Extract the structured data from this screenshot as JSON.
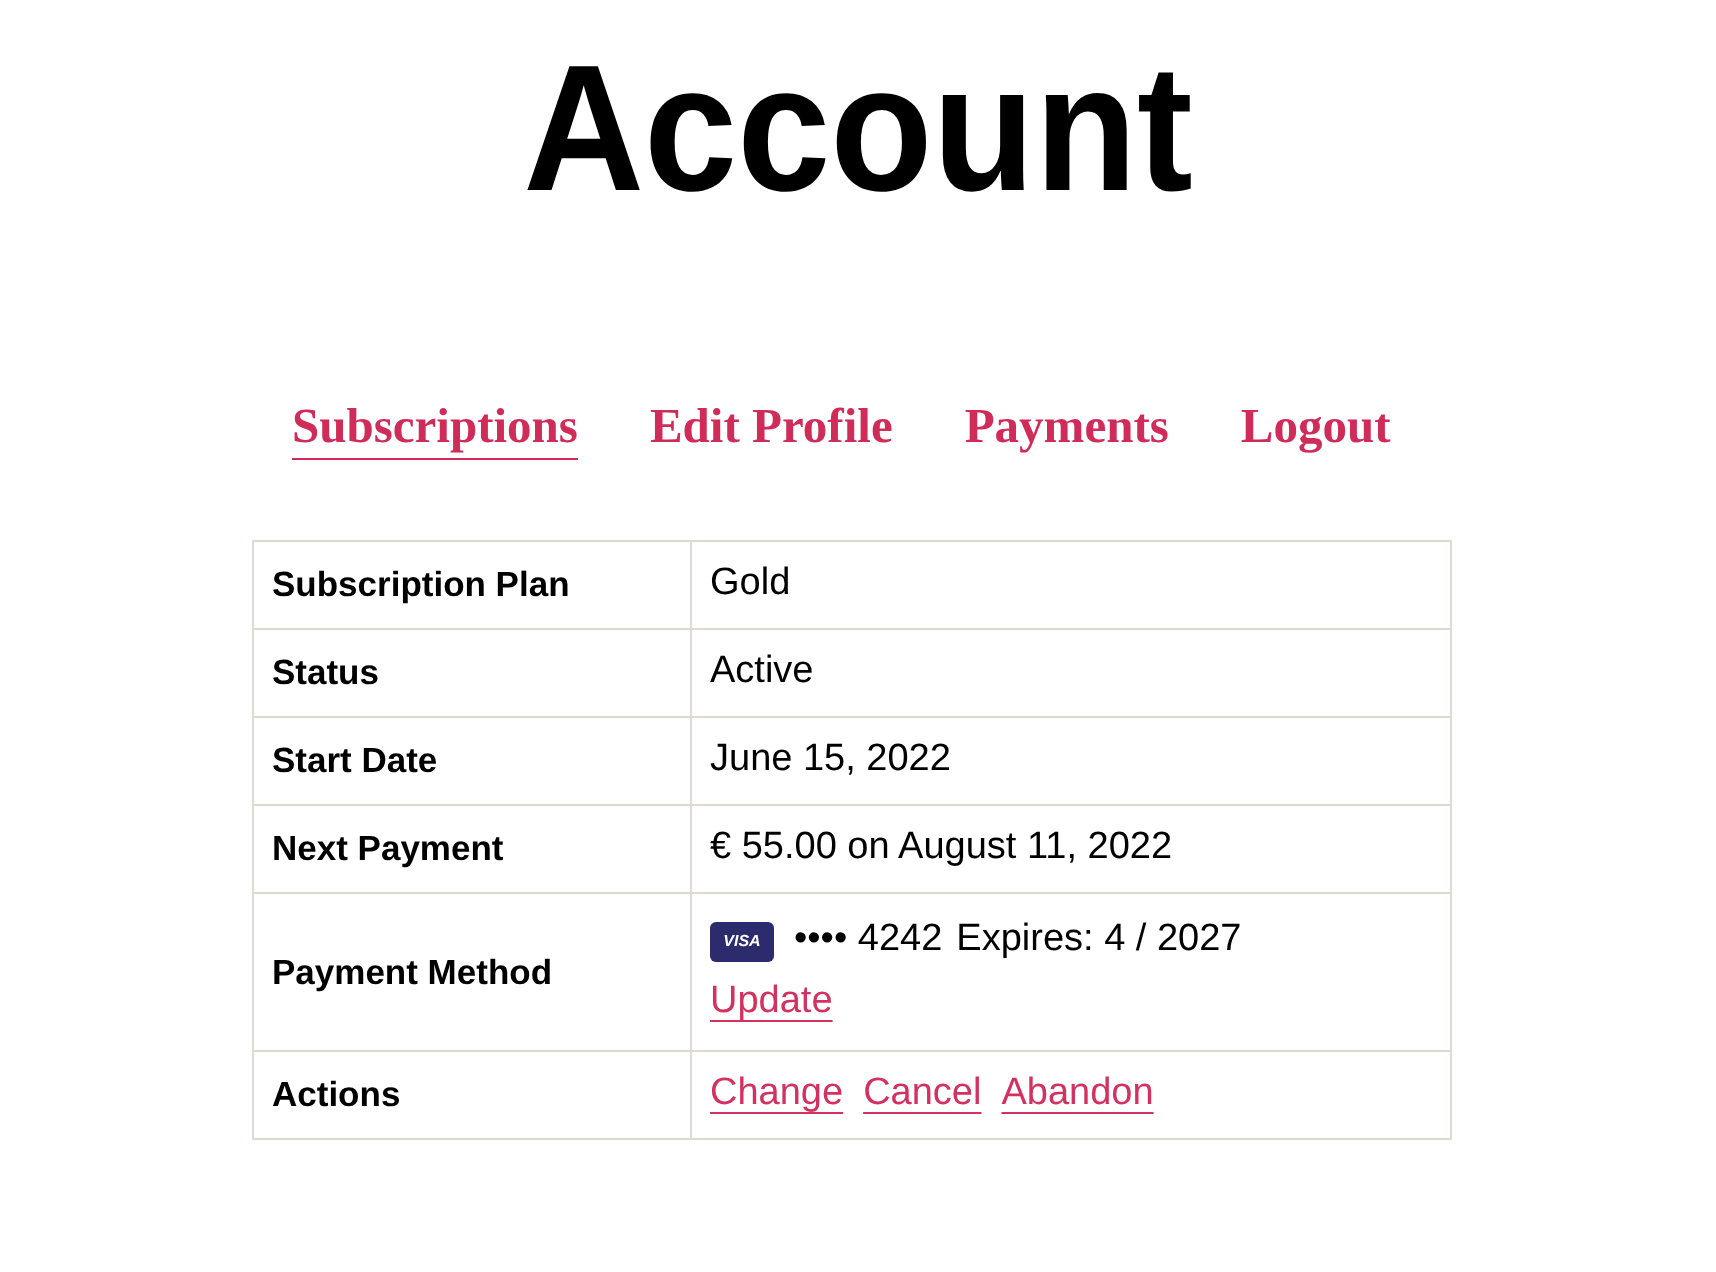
{
  "title": "Account",
  "nav": [
    {
      "label": "Subscriptions",
      "selected": true
    },
    {
      "label": "Edit Profile",
      "selected": false
    },
    {
      "label": "Payments",
      "selected": false
    },
    {
      "label": "Logout",
      "selected": false
    }
  ],
  "table": {
    "rows": [
      {
        "kind": "text",
        "label": "Subscription Plan",
        "value": "Gold"
      },
      {
        "kind": "text",
        "label": "Status",
        "value": "Active"
      },
      {
        "kind": "text",
        "label": "Start Date",
        "value": "June 15, 2022"
      },
      {
        "kind": "text",
        "label": "Next Payment",
        "value": "€ 55.00 on August 11, 2022"
      },
      {
        "kind": "payment",
        "label": "Payment Method",
        "card_brand": "VISA",
        "card_number": "•••• 4242",
        "expires": "Expires: 4 / 2027",
        "links": [
          "Update"
        ]
      },
      {
        "kind": "links",
        "label": "Actions",
        "links": [
          "Change",
          "Cancel",
          "Abandon"
        ]
      }
    ]
  }
}
